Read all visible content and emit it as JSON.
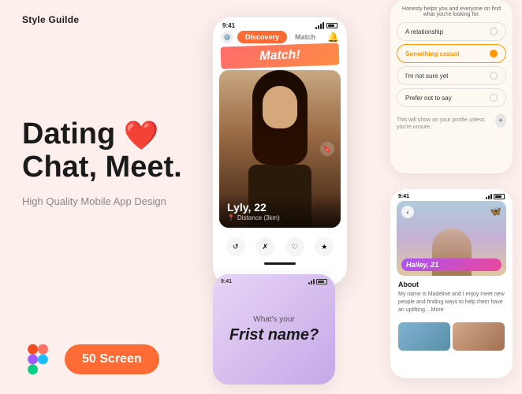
{
  "header": {
    "brand": "Style Guilde"
  },
  "hero": {
    "line1": "Dating ❤️",
    "line2": "Chat, Meet.",
    "subtitle": "High Quality Mobile App Design"
  },
  "badge": {
    "screens": "50 Screen"
  },
  "phone_center": {
    "time": "9:41",
    "tabs": [
      "Discovery",
      "Match"
    ],
    "active_tab": "Discovery",
    "match_text": "Match!",
    "profile_name": "Lyly, 22",
    "profile_distance": "Distance (3km)",
    "actions": [
      "↺",
      "✗",
      "♡",
      "★"
    ]
  },
  "phone_right_top": {
    "intro_text": "Honesty helps you and everyone on find what you're looking for.",
    "options": [
      {
        "label": "A relationship",
        "selected": false
      },
      {
        "label": "Something casual",
        "selected": true
      },
      {
        "label": "I'm not sure yet",
        "selected": false
      },
      {
        "label": "Prefer not to say",
        "selected": false
      }
    ],
    "note": "This will show on your profile unless you're unsure."
  },
  "phone_right_bottom": {
    "time": "9:41",
    "back_label": "‹",
    "profile_name": "Hailey, 21",
    "about_title": "About",
    "about_text": "My name is Madeline and I enjoy meet new people and finding ways to help them have an uplifting... More"
  },
  "phone_bottom": {
    "time": "9:41",
    "question_label": "What's your",
    "question_main": "Frist name?"
  },
  "colors": {
    "bg": "#fdf0ec",
    "accent": "#ff6b35",
    "purple": "#a855f7",
    "pink": "#ec4899"
  }
}
